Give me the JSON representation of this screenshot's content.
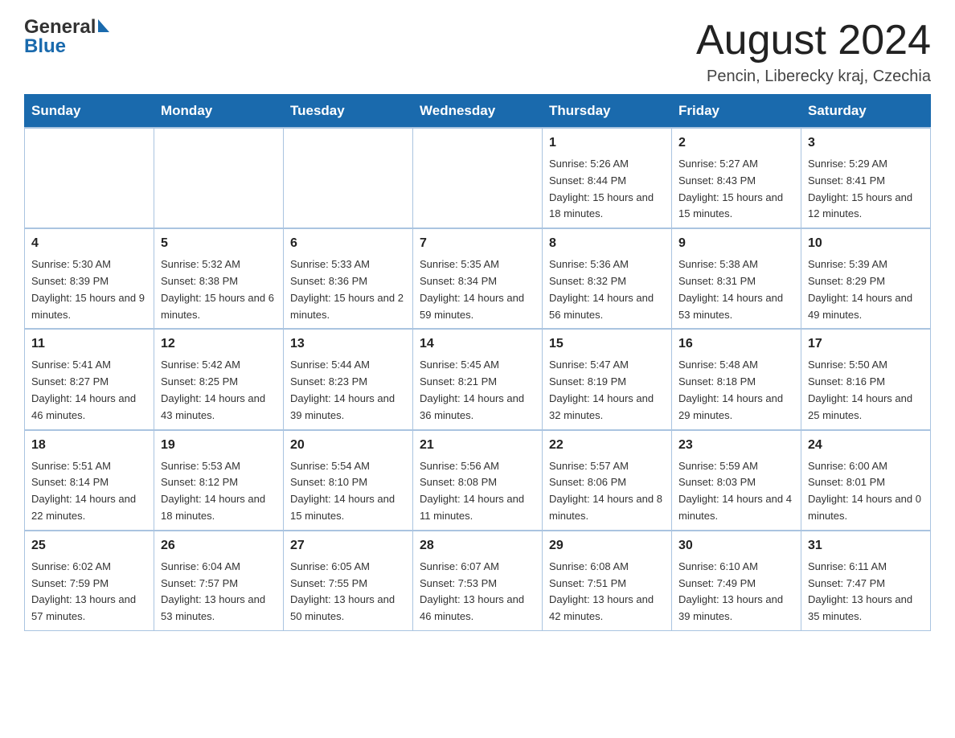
{
  "header": {
    "month_title": "August 2024",
    "subtitle": "Pencin, Liberecky kraj, Czechia"
  },
  "days_of_week": [
    "Sunday",
    "Monday",
    "Tuesday",
    "Wednesday",
    "Thursday",
    "Friday",
    "Saturday"
  ],
  "weeks": [
    {
      "days": [
        {
          "num": "",
          "info": ""
        },
        {
          "num": "",
          "info": ""
        },
        {
          "num": "",
          "info": ""
        },
        {
          "num": "",
          "info": ""
        },
        {
          "num": "1",
          "info": "Sunrise: 5:26 AM\nSunset: 8:44 PM\nDaylight: 15 hours and 18 minutes."
        },
        {
          "num": "2",
          "info": "Sunrise: 5:27 AM\nSunset: 8:43 PM\nDaylight: 15 hours and 15 minutes."
        },
        {
          "num": "3",
          "info": "Sunrise: 5:29 AM\nSunset: 8:41 PM\nDaylight: 15 hours and 12 minutes."
        }
      ]
    },
    {
      "days": [
        {
          "num": "4",
          "info": "Sunrise: 5:30 AM\nSunset: 8:39 PM\nDaylight: 15 hours and 9 minutes."
        },
        {
          "num": "5",
          "info": "Sunrise: 5:32 AM\nSunset: 8:38 PM\nDaylight: 15 hours and 6 minutes."
        },
        {
          "num": "6",
          "info": "Sunrise: 5:33 AM\nSunset: 8:36 PM\nDaylight: 15 hours and 2 minutes."
        },
        {
          "num": "7",
          "info": "Sunrise: 5:35 AM\nSunset: 8:34 PM\nDaylight: 14 hours and 59 minutes."
        },
        {
          "num": "8",
          "info": "Sunrise: 5:36 AM\nSunset: 8:32 PM\nDaylight: 14 hours and 56 minutes."
        },
        {
          "num": "9",
          "info": "Sunrise: 5:38 AM\nSunset: 8:31 PM\nDaylight: 14 hours and 53 minutes."
        },
        {
          "num": "10",
          "info": "Sunrise: 5:39 AM\nSunset: 8:29 PM\nDaylight: 14 hours and 49 minutes."
        }
      ]
    },
    {
      "days": [
        {
          "num": "11",
          "info": "Sunrise: 5:41 AM\nSunset: 8:27 PM\nDaylight: 14 hours and 46 minutes."
        },
        {
          "num": "12",
          "info": "Sunrise: 5:42 AM\nSunset: 8:25 PM\nDaylight: 14 hours and 43 minutes."
        },
        {
          "num": "13",
          "info": "Sunrise: 5:44 AM\nSunset: 8:23 PM\nDaylight: 14 hours and 39 minutes."
        },
        {
          "num": "14",
          "info": "Sunrise: 5:45 AM\nSunset: 8:21 PM\nDaylight: 14 hours and 36 minutes."
        },
        {
          "num": "15",
          "info": "Sunrise: 5:47 AM\nSunset: 8:19 PM\nDaylight: 14 hours and 32 minutes."
        },
        {
          "num": "16",
          "info": "Sunrise: 5:48 AM\nSunset: 8:18 PM\nDaylight: 14 hours and 29 minutes."
        },
        {
          "num": "17",
          "info": "Sunrise: 5:50 AM\nSunset: 8:16 PM\nDaylight: 14 hours and 25 minutes."
        }
      ]
    },
    {
      "days": [
        {
          "num": "18",
          "info": "Sunrise: 5:51 AM\nSunset: 8:14 PM\nDaylight: 14 hours and 22 minutes."
        },
        {
          "num": "19",
          "info": "Sunrise: 5:53 AM\nSunset: 8:12 PM\nDaylight: 14 hours and 18 minutes."
        },
        {
          "num": "20",
          "info": "Sunrise: 5:54 AM\nSunset: 8:10 PM\nDaylight: 14 hours and 15 minutes."
        },
        {
          "num": "21",
          "info": "Sunrise: 5:56 AM\nSunset: 8:08 PM\nDaylight: 14 hours and 11 minutes."
        },
        {
          "num": "22",
          "info": "Sunrise: 5:57 AM\nSunset: 8:06 PM\nDaylight: 14 hours and 8 minutes."
        },
        {
          "num": "23",
          "info": "Sunrise: 5:59 AM\nSunset: 8:03 PM\nDaylight: 14 hours and 4 minutes."
        },
        {
          "num": "24",
          "info": "Sunrise: 6:00 AM\nSunset: 8:01 PM\nDaylight: 14 hours and 0 minutes."
        }
      ]
    },
    {
      "days": [
        {
          "num": "25",
          "info": "Sunrise: 6:02 AM\nSunset: 7:59 PM\nDaylight: 13 hours and 57 minutes."
        },
        {
          "num": "26",
          "info": "Sunrise: 6:04 AM\nSunset: 7:57 PM\nDaylight: 13 hours and 53 minutes."
        },
        {
          "num": "27",
          "info": "Sunrise: 6:05 AM\nSunset: 7:55 PM\nDaylight: 13 hours and 50 minutes."
        },
        {
          "num": "28",
          "info": "Sunrise: 6:07 AM\nSunset: 7:53 PM\nDaylight: 13 hours and 46 minutes."
        },
        {
          "num": "29",
          "info": "Sunrise: 6:08 AM\nSunset: 7:51 PM\nDaylight: 13 hours and 42 minutes."
        },
        {
          "num": "30",
          "info": "Sunrise: 6:10 AM\nSunset: 7:49 PM\nDaylight: 13 hours and 39 minutes."
        },
        {
          "num": "31",
          "info": "Sunrise: 6:11 AM\nSunset: 7:47 PM\nDaylight: 13 hours and 35 minutes."
        }
      ]
    }
  ]
}
